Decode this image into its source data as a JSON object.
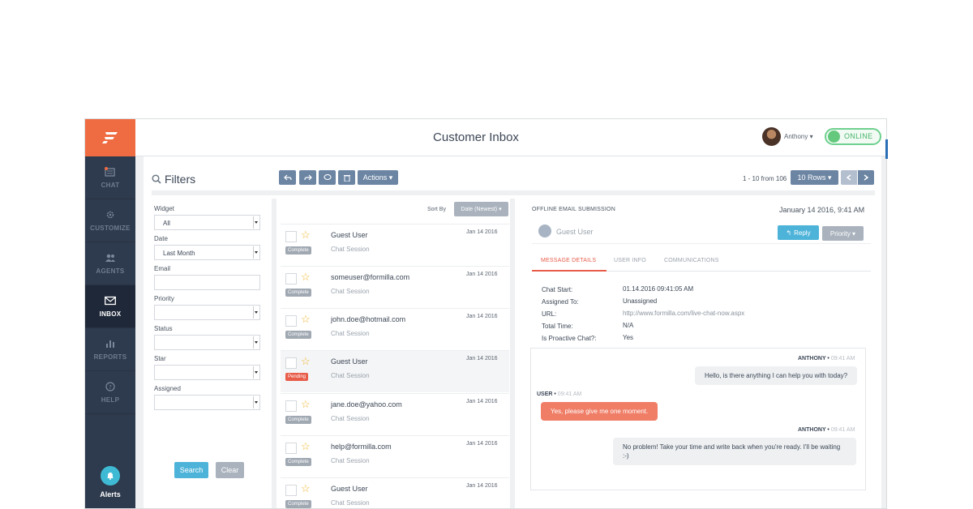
{
  "app": {
    "title": "Customer Inbox"
  },
  "user": {
    "name": "Anthony ▾",
    "status": "ONLINE"
  },
  "sidebar": {
    "items": [
      {
        "label": "CHAT"
      },
      {
        "label": "CUSTOMIZE"
      },
      {
        "label": "AGENTS"
      },
      {
        "label": "INBOX"
      },
      {
        "label": "REPORTS"
      },
      {
        "label": "HELP"
      }
    ],
    "alerts_label": "Alerts"
  },
  "filters": {
    "title": "Filters",
    "widget_label": "Widget",
    "widget_value": "All",
    "date_label": "Date",
    "date_value": "Last Month",
    "email_label": "Email",
    "priority_label": "Priority",
    "status_label": "Status",
    "star_label": "Star",
    "assigned_label": "Assigned",
    "search_label": "Search",
    "clear_label": "Clear"
  },
  "toolbar": {
    "actions_label": "Actions ▾",
    "pager": "1 - 10 from 106",
    "rows_label": "10 Rows ▾"
  },
  "list": {
    "sort_label": "Sort By",
    "sort_value": "Date (Newest) ▾",
    "items": [
      {
        "name": "Guest User",
        "sub": "Chat Session",
        "date": "Jan 14 2016",
        "badge": "Complete"
      },
      {
        "name": "someuser@formilla.com",
        "sub": "Chat Session",
        "date": "Jan 14 2016",
        "badge": "Complete"
      },
      {
        "name": "john.doe@hotmail.com",
        "sub": "Chat Session",
        "date": "Jan 14 2016",
        "badge": "Complete"
      },
      {
        "name": "Guest User",
        "sub": "Chat Session",
        "date": "Jan 14 2016",
        "badge": "Pending"
      },
      {
        "name": "jane.doe@yahoo.com",
        "sub": "Chat Session",
        "date": "Jan 14 2016",
        "badge": "Complete"
      },
      {
        "name": "help@formilla.com",
        "sub": "Chat Session",
        "date": "Jan 14 2016",
        "badge": "Complete"
      },
      {
        "name": "Guest User",
        "sub": "Chat Session",
        "date": "Jan 14 2016",
        "badge": "Complete"
      }
    ]
  },
  "detail": {
    "heading": "OFFLINE EMAIL SUBMISSION",
    "date": "January 14 2016, 9:41 AM",
    "guest": "Guest User",
    "reply_label": "Reply",
    "priority_label": "Priority ▾",
    "tabs": [
      "MESSAGE DETAILS",
      "USER INFO",
      "COMMUNICATIONS"
    ],
    "fields": [
      {
        "key": "Chat Start:",
        "value": "01.14.2016 09:41:05 AM"
      },
      {
        "key": "Assigned To:",
        "value": "Unassigned"
      },
      {
        "key": "URL:",
        "value": "http://www.formilla.com/live-chat-now.aspx"
      },
      {
        "key": "Total Time:",
        "value": "N/A"
      },
      {
        "key": "Is Proactive Chat?:",
        "value": "Yes"
      }
    ],
    "messages": [
      {
        "from": "ANTHONY",
        "time": "09:41 AM",
        "text": "Hello, is there anything I can help you with today?"
      },
      {
        "from": "USER",
        "time": "09:41 AM",
        "text": "Yes, please give me one moment."
      },
      {
        "from": "ANTHONY",
        "time": "09:41 AM",
        "text": "No problem! Take your time and write back when you're ready. I'll be waiting :-)"
      }
    ]
  },
  "colors": {
    "brand": "#ef6c43",
    "sidebar": "#2e3a4d",
    "online": "#64c97d",
    "accent": "#4db3d9",
    "pending": "#e85c4a"
  }
}
